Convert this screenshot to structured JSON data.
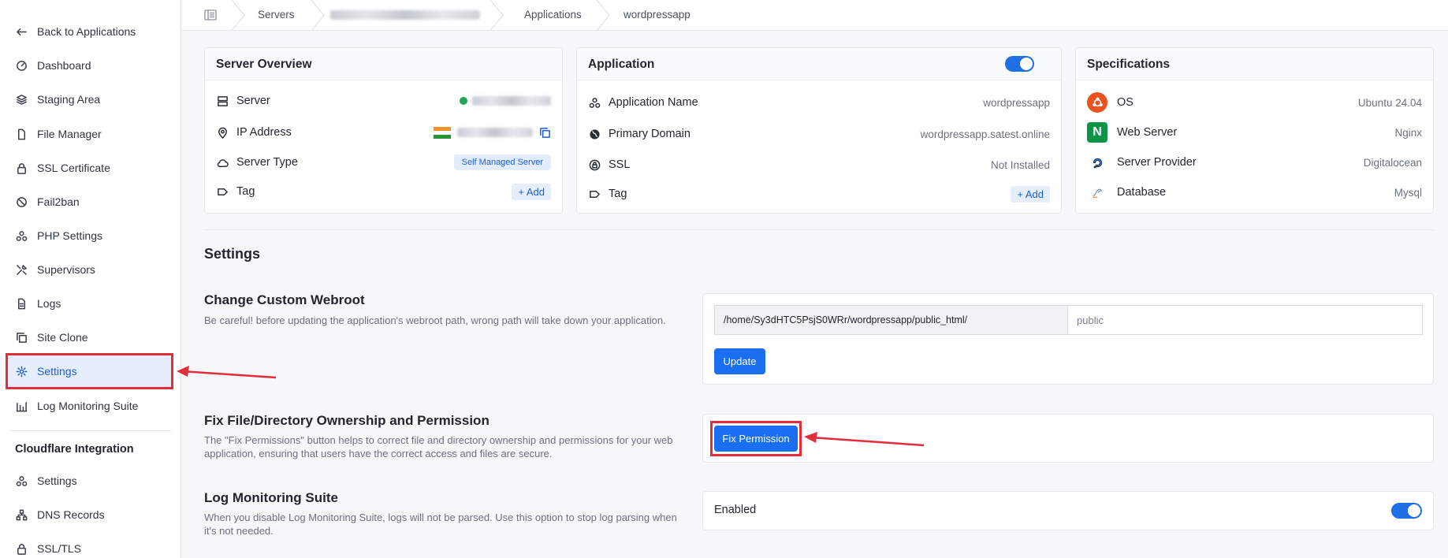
{
  "sidebar": {
    "items": [
      {
        "label": "Back to Applications",
        "icon": "arrow-left-icon"
      },
      {
        "label": "Dashboard",
        "icon": "dashboard-gauge-icon"
      },
      {
        "label": "Staging Area",
        "icon": "layers-icon"
      },
      {
        "label": "File Manager",
        "icon": "file-icon"
      },
      {
        "label": "SSL Certificate",
        "icon": "lock-icon"
      },
      {
        "label": "Fail2ban",
        "icon": "ban-icon"
      },
      {
        "label": "PHP Settings",
        "icon": "cubes-icon"
      },
      {
        "label": "Supervisors",
        "icon": "tools-icon"
      },
      {
        "label": "Logs",
        "icon": "document-icon"
      },
      {
        "label": "Site Clone",
        "icon": "copy-icon"
      },
      {
        "label": "Settings",
        "icon": "gear-icon",
        "active": true
      },
      {
        "label": "Log Monitoring Suite",
        "icon": "bar-chart-icon"
      }
    ],
    "cloudflare_heading": "Cloudflare Integration",
    "cloudflare_items": [
      {
        "label": "Settings",
        "icon": "cubes-icon"
      },
      {
        "label": "DNS Records",
        "icon": "network-icon"
      },
      {
        "label": "SSL/TLS",
        "icon": "lock-icon"
      }
    ]
  },
  "breadcrumb": {
    "items": [
      "Servers",
      "Applications",
      "wordpressapp"
    ]
  },
  "server_overview": {
    "title": "Server Overview",
    "server_label": "Server",
    "ip_label": "IP Address",
    "type_label": "Server Type",
    "type_value": "Self Managed Server",
    "tag_label": "Tag",
    "add_label": "+ Add"
  },
  "application": {
    "title": "Application",
    "name_label": "Application Name",
    "name_value": "wordpressapp",
    "domain_label": "Primary Domain",
    "domain_value": "wordpressapp.satest.online",
    "ssl_label": "SSL",
    "ssl_value": "Not Installed",
    "tag_label": "Tag",
    "add_label": "+ Add",
    "enabled": true
  },
  "specifications": {
    "title": "Specifications",
    "rows": [
      {
        "label": "OS",
        "value": "Ubuntu 24.04",
        "icon": "ubuntu-icon"
      },
      {
        "label": "Web Server",
        "value": "Nginx",
        "icon": "nginx-icon"
      },
      {
        "label": "Server Provider",
        "value": "Digitalocean",
        "icon": "digitalocean-icon"
      },
      {
        "label": "Database",
        "value": "Mysql",
        "icon": "mysql-icon"
      }
    ]
  },
  "settings": {
    "heading": "Settings",
    "webroot": {
      "title": "Change Custom Webroot",
      "desc": "Be careful! before updating the application's webroot path, wrong path will take down your application.",
      "path_value": "/home/Sy3dHTC5PsjS0WRr/wordpressapp/public_html/",
      "folder_placeholder": "public",
      "update_label": "Update"
    },
    "permission": {
      "title": "Fix File/Directory Ownership and Permission",
      "desc": "The \"Fix Permissions\" button helps to correct file and directory ownership and permissions for your web application, ensuring that users have the correct access and files are secure.",
      "button_label": "Fix Permission"
    },
    "log_monitoring": {
      "title": "Log Monitoring Suite",
      "desc": "When you disable Log Monitoring Suite, logs will not be parsed. Use this option to stop log parsing when it's not needed.",
      "status_label": "Enabled",
      "enabled": true
    }
  },
  "colors": {
    "accent": "#1a6ff0",
    "highlight": "#e22d3b",
    "danger": "#e2343e"
  }
}
